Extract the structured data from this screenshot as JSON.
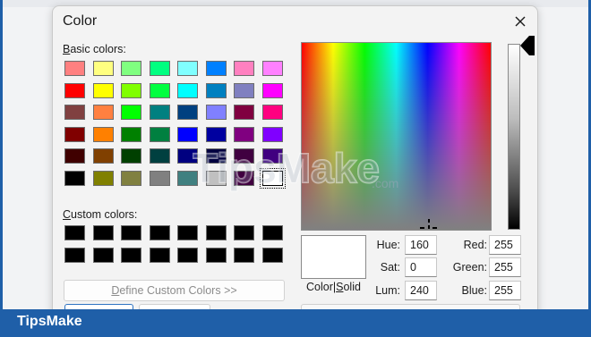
{
  "dialog": {
    "title": "Color",
    "close_icon": "close-icon"
  },
  "basic": {
    "label_underline": "B",
    "label_rest": "asic colors:",
    "colors": [
      "#ff8080",
      "#ffff80",
      "#80ff80",
      "#00ff80",
      "#80ffff",
      "#0080ff",
      "#ff80c0",
      "#ff80ff",
      "#ff0000",
      "#ffff00",
      "#80ff00",
      "#00ff40",
      "#00ffff",
      "#0080c0",
      "#8080c0",
      "#ff00ff",
      "#804040",
      "#ff8040",
      "#00ff00",
      "#008080",
      "#004080",
      "#8080ff",
      "#800040",
      "#ff0080",
      "#800000",
      "#ff8000",
      "#008000",
      "#008040",
      "#0000ff",
      "#0000a0",
      "#800080",
      "#8000ff",
      "#400000",
      "#804000",
      "#004000",
      "#004040",
      "#000080",
      "#000040",
      "#400040",
      "#400080",
      "#000000",
      "#808000",
      "#808040",
      "#808080",
      "#408080",
      "#c0c0c0",
      "#400040",
      "#ffffff"
    ],
    "selected_index": 47
  },
  "custom": {
    "label_underline": "C",
    "label_rest": "ustom colors:",
    "colors": [
      "#000000",
      "#000000",
      "#000000",
      "#000000",
      "#000000",
      "#000000",
      "#000000",
      "#000000",
      "#000000",
      "#000000",
      "#000000",
      "#000000",
      "#000000",
      "#000000",
      "#000000",
      "#000000"
    ]
  },
  "buttons": {
    "define_underline": "D",
    "define_rest": "efine Custom Colors >>"
  },
  "preview": {
    "label_a": "Color|",
    "label_underline": "S",
    "label_b": "olid",
    "color": "#ffffff"
  },
  "fields": {
    "hue_label": "Hue:",
    "hue_underline": "e",
    "hue_value": "160",
    "sat_label": "Sat:",
    "sat_value": "0",
    "lum_label": "Lum:",
    "lum_value": "240",
    "red_label": "Red:",
    "red_value": "255",
    "green_label": "Green:",
    "green_value": "255",
    "blue_label": "Blue:",
    "blue_value": "255"
  },
  "watermark": {
    "brand": "TipsMake",
    "suffix": ".com"
  },
  "footer": {
    "brand": "TipsMake"
  }
}
